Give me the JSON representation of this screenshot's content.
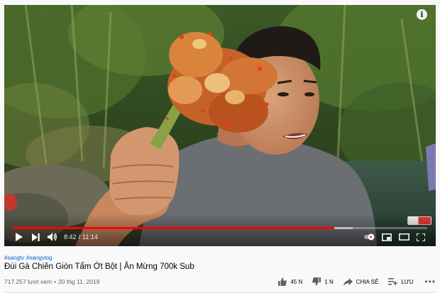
{
  "video": {
    "current_time": "8:42",
    "time_separator": "/",
    "duration": "11:14",
    "progress_fraction": 0.775,
    "buffered_fraction": 0.82,
    "info_glyph": "i"
  },
  "controls": {
    "left": [
      "play-icon",
      "next-icon",
      "volume-icon"
    ],
    "right": [
      "autoplay-toggle-icon",
      "miniplayer-icon",
      "theater-icon",
      "fullscreen-icon"
    ]
  },
  "hashtags": [
    "#sangtv",
    "#sangvlog"
  ],
  "title": "Đùi Gà Chiên Giòn Tẩm Ớt Bột | Ăn Mừng 700k Sub",
  "meta": {
    "views": "717.257 lượt xem",
    "separator": "•",
    "date": "20 thg 11, 2019"
  },
  "actions": {
    "like_count": "45 N",
    "dislike_count": "1 N",
    "share_label": "CHIA SẺ",
    "save_label": "LƯU",
    "more_glyph": "•••"
  },
  "colors": {
    "progress": "#ff0000",
    "hashtag": "#065fd4",
    "background": "#f9f9f9"
  }
}
